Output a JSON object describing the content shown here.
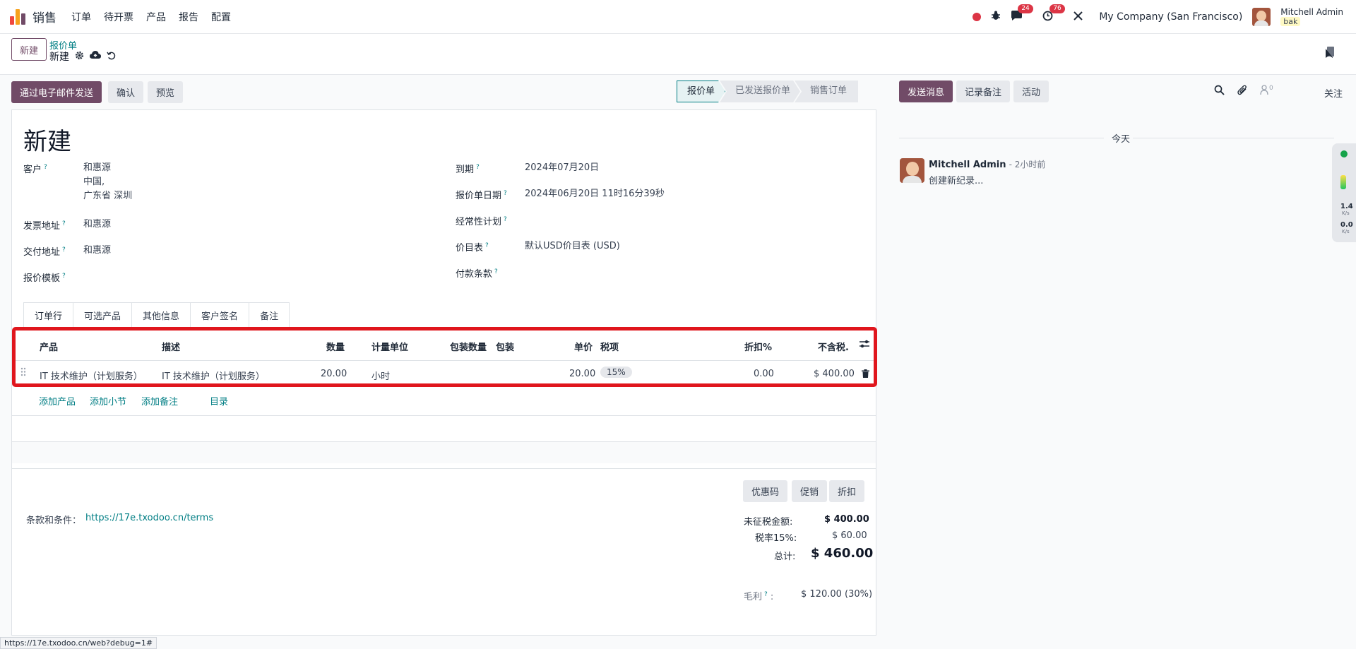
{
  "navbar": {
    "app_name": "销售",
    "menu": [
      "订单",
      "待开票",
      "产品",
      "报告",
      "配置"
    ],
    "messages_badge": "24",
    "activities_badge": "76",
    "company": "My Company (San Francisco)",
    "user_name": "Mitchell Admin",
    "user_db": "bak"
  },
  "control": {
    "new_button": "新建",
    "breadcrumb_parent": "报价单",
    "breadcrumb_current": "新建"
  },
  "actions": {
    "send_email": "通过电子邮件发送",
    "confirm": "确认",
    "preview": "预览"
  },
  "status": {
    "stages": [
      "报价单",
      "已发送报价单",
      "销售订单"
    ],
    "active": "报价单"
  },
  "form": {
    "title": "新建",
    "customer_label": "客户",
    "customer_name": "和惠源",
    "customer_country": "中国,",
    "customer_city": "广东省 深圳",
    "invoice_address_label": "发票地址",
    "invoice_address": "和惠源",
    "delivery_address_label": "交付地址",
    "delivery_address": "和惠源",
    "template_label": "报价模板",
    "expiration_label": "到期",
    "expiration": "2024年07月20日",
    "quote_date_label": "报价单日期",
    "quote_date": "2024年06月20日 11时16分39秒",
    "recurring_label": "经常性计划",
    "pricelist_label": "价目表",
    "pricelist": "默认USD价目表 (USD)",
    "payment_terms_label": "付款条款"
  },
  "tabs": [
    "订单行",
    "可选产品",
    "其他信息",
    "客户签名",
    "备注"
  ],
  "order_lines": {
    "headers": {
      "product": "产品",
      "description": "描述",
      "quantity": "数量",
      "uom": "计量单位",
      "pkg_qty": "包装数量",
      "pkg": "包装",
      "unit_price": "单价",
      "taxes": "税项",
      "discount": "折扣%",
      "subtotal": "不含税."
    },
    "rows": [
      {
        "product": "IT 技术维护（计划服务）",
        "description": "IT 技术维护（计划服务）",
        "quantity": "20.00",
        "uom": "小时",
        "unit_price": "20.00",
        "tax": "15%",
        "discount": "0.00",
        "subtotal": "$ 400.00"
      }
    ],
    "add_product": "添加产品",
    "add_section": "添加小节",
    "add_note": "添加备注",
    "catalog": "目录"
  },
  "footer": {
    "coupon": "优惠码",
    "promotion": "促销",
    "discount": "折扣",
    "terms_label": "条款和条件：",
    "terms_url": "https://17e.txodoo.cn/terms",
    "untaxed_label": "未征税金额:",
    "untaxed": "$ 400.00",
    "tax_label": "税率15%:",
    "tax": "$ 60.00",
    "total_label": "总计:",
    "total": "$ 460.00",
    "margin_label": "毛利",
    "margin": "$ 120.00 (30%)"
  },
  "chatter": {
    "send_message": "发送消息",
    "log_note": "记录备注",
    "activity": "活动",
    "followers_count": "0",
    "follow": "关注",
    "today": "今天",
    "author": "Mitchell Admin",
    "time": "- 2小时前",
    "body": "创建新纪录..."
  },
  "side_widget": {
    "up": "1.4",
    "down": "0.0",
    "unit": "K/s"
  },
  "status_url": "https://17e.txodoo.cn/web?debug=1#"
}
